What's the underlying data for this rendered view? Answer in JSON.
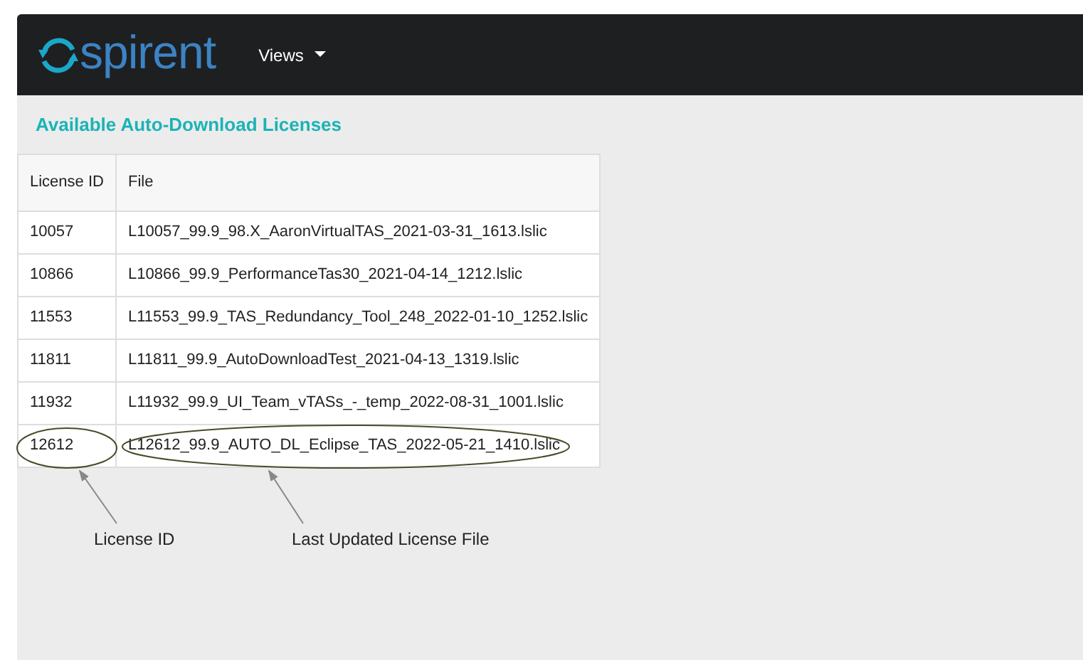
{
  "navbar": {
    "logo": "spirent",
    "menu": {
      "label": "Views"
    }
  },
  "page": {
    "title": "Available Auto-Download Licenses"
  },
  "table": {
    "columns": [
      "License ID",
      "File"
    ],
    "rows": [
      [
        "10057",
        "L10057_99.9_98.X_AaronVirtualTAS_2021-03-31_1613.lslic"
      ],
      [
        "10866",
        "L10866_99.9_PerformanceTas30_2021-04-14_1212.lslic"
      ],
      [
        "11553",
        "L11553_99.9_TAS_Redundancy_Tool_248_2022-01-10_1252.lslic"
      ],
      [
        "11811",
        "L11811_99.9_AutoDownloadTest_2021-04-13_1319.lslic"
      ],
      [
        "11932",
        "L11932_99.9_UI_Team_vTASs_-_temp_2022-08-31_1001.lslic"
      ],
      [
        "12612",
        "L12612_99.9_AUTO_DL_Eclipse_TAS_2022-05-21_1410.lslic"
      ]
    ]
  },
  "annotations": [
    {
      "label": "License ID"
    },
    {
      "label": "Last Updated License File"
    }
  ]
}
